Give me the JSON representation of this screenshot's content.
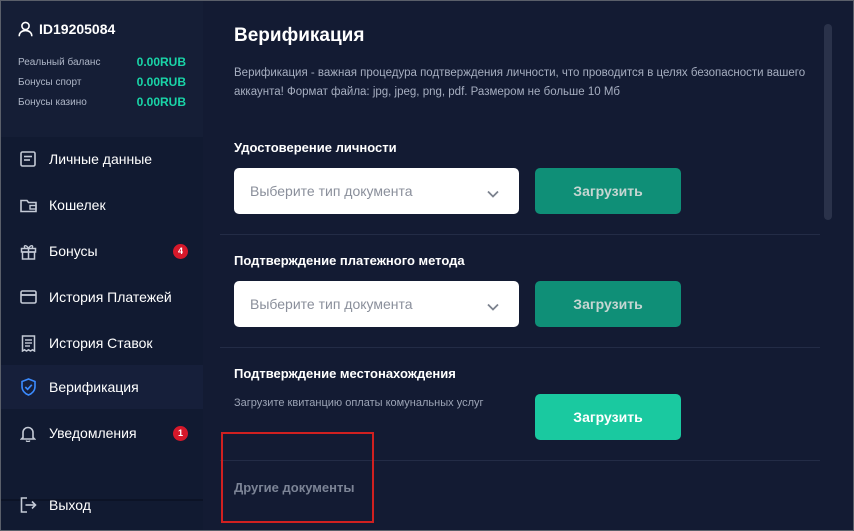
{
  "user": {
    "id": "ID19205084",
    "balances": [
      {
        "label": "Реальный баланс",
        "value": "0.00RUB"
      },
      {
        "label": "Бонусы спорт",
        "value": "0.00RUB"
      },
      {
        "label": "Бонусы казино",
        "value": "0.00RUB"
      }
    ]
  },
  "sidebar": {
    "items": [
      {
        "label": "Личные данные",
        "icon": "profile-card-icon"
      },
      {
        "label": "Кошелек",
        "icon": "wallet-icon"
      },
      {
        "label": "Бонусы",
        "icon": "gift-icon",
        "badge": "4"
      },
      {
        "label": "История Платежей",
        "icon": "card-icon"
      },
      {
        "label": "История Ставок",
        "icon": "receipt-icon"
      },
      {
        "label": "Верификация",
        "icon": "shield-check-icon",
        "active": true
      },
      {
        "label": "Уведомления",
        "icon": "bell-icon",
        "badge": "1"
      }
    ],
    "logout_label": "Выход"
  },
  "main": {
    "title": "Верификация",
    "description": "Верификация - важная процедура подтверждения личности, что проводится в целях безопасности вашего аккаунта! Формат файла: jpg, jpeg, png, pdf. Размером не больше 10 Мб",
    "sections": [
      {
        "title": "Удостоверение личности",
        "select_placeholder": "Выберите тип документа",
        "button": "Загрузить"
      },
      {
        "title": "Подтверждение платежного метода",
        "select_placeholder": "Выберите тип документа",
        "button": "Загрузить"
      },
      {
        "title": "Подтверждение местонахождения",
        "hint": "Загрузите квитанцию оплаты комунальных услуг",
        "button": "Загрузить"
      }
    ],
    "other_docs_title": "Другие документы"
  },
  "colors": {
    "accent": "#1ac9a0",
    "accent_dim": "#0f8f77",
    "balance_green": "#19d5a8",
    "badge_red": "#d6182a",
    "bg": "#131b33",
    "sidebar_bg": "#111a31",
    "highlight": "#d02020"
  }
}
